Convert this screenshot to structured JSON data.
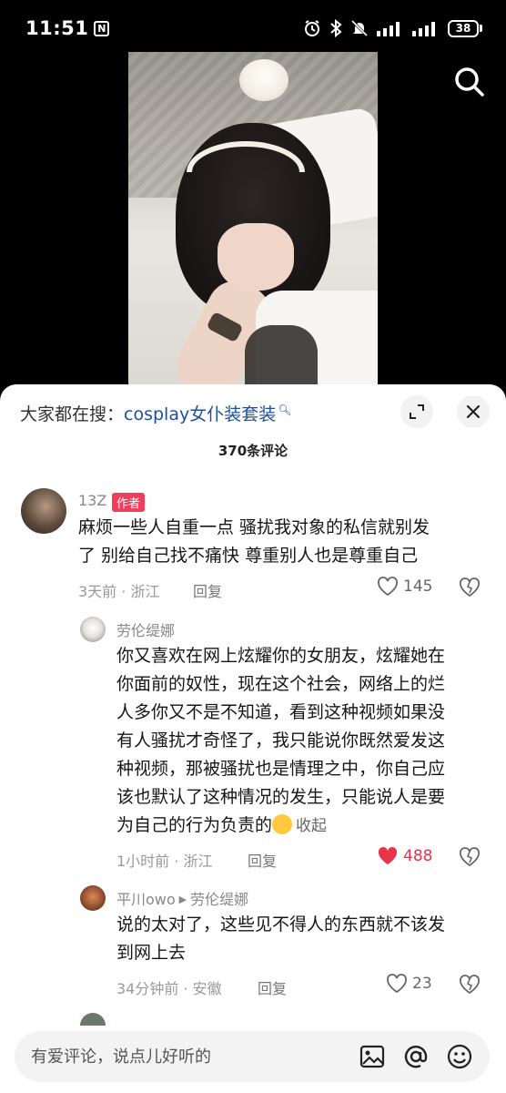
{
  "status_bar": {
    "time": "11:51",
    "nfc_label": "N",
    "battery": "38"
  },
  "panel": {
    "searching_prefix": "大家都在搜：",
    "searching_term": "cosplay女仆装套装",
    "comment_count": "370条评论"
  },
  "comments": [
    {
      "name": "13Z",
      "badge": "作者",
      "text_line1": "麻烦一些人自重一点  骚扰我对象的私信就别发",
      "text_line2": "了 别给自己找不痛快 尊重别人也是尊重自己",
      "meta": "3天前 · 浙江",
      "reply_label": "回复",
      "likes": "145"
    },
    {
      "name": "劳伦缇娜",
      "text_lines": [
        "你又喜欢在网上炫耀你的女朋友，炫耀她在",
        "你面前的奴性，现在这个社会，网络上的烂",
        "人多你又不是不知道，看到这种视频如果没",
        "有人骚扰才奇怪了，我只能说你既然爱发这",
        "种视频，那被骚扰也是情理之中，你自己应",
        "该也默认了这种情况的发生，只能说人是要",
        "为自己的行为负责的"
      ],
      "collapse_label": "收起",
      "meta": "1小时前 · 浙江",
      "reply_label": "回复",
      "likes": "488"
    },
    {
      "name": "平川owo",
      "reply_to": "劳伦缇娜",
      "text_line1": "说的太对了，这些见不得人的东西就不该发",
      "text_line2": "到网上去",
      "meta": "34分钟前 · 安徽",
      "reply_label": "回复",
      "likes": "23"
    }
  ],
  "input": {
    "placeholder": "有爱评论，说点儿好听的"
  },
  "icons": {
    "search": "search-icon",
    "expand": "expand-icon",
    "close": "close-icon",
    "heart": "heart-icon",
    "broken_heart": "broken-heart-icon",
    "image": "image-icon",
    "mention": "at-icon",
    "emoji": "emoji-icon"
  },
  "colors": {
    "accent_link": "#1c4f9c",
    "author_badge": "#f33d5a",
    "liked_heart": "#e8334a"
  }
}
